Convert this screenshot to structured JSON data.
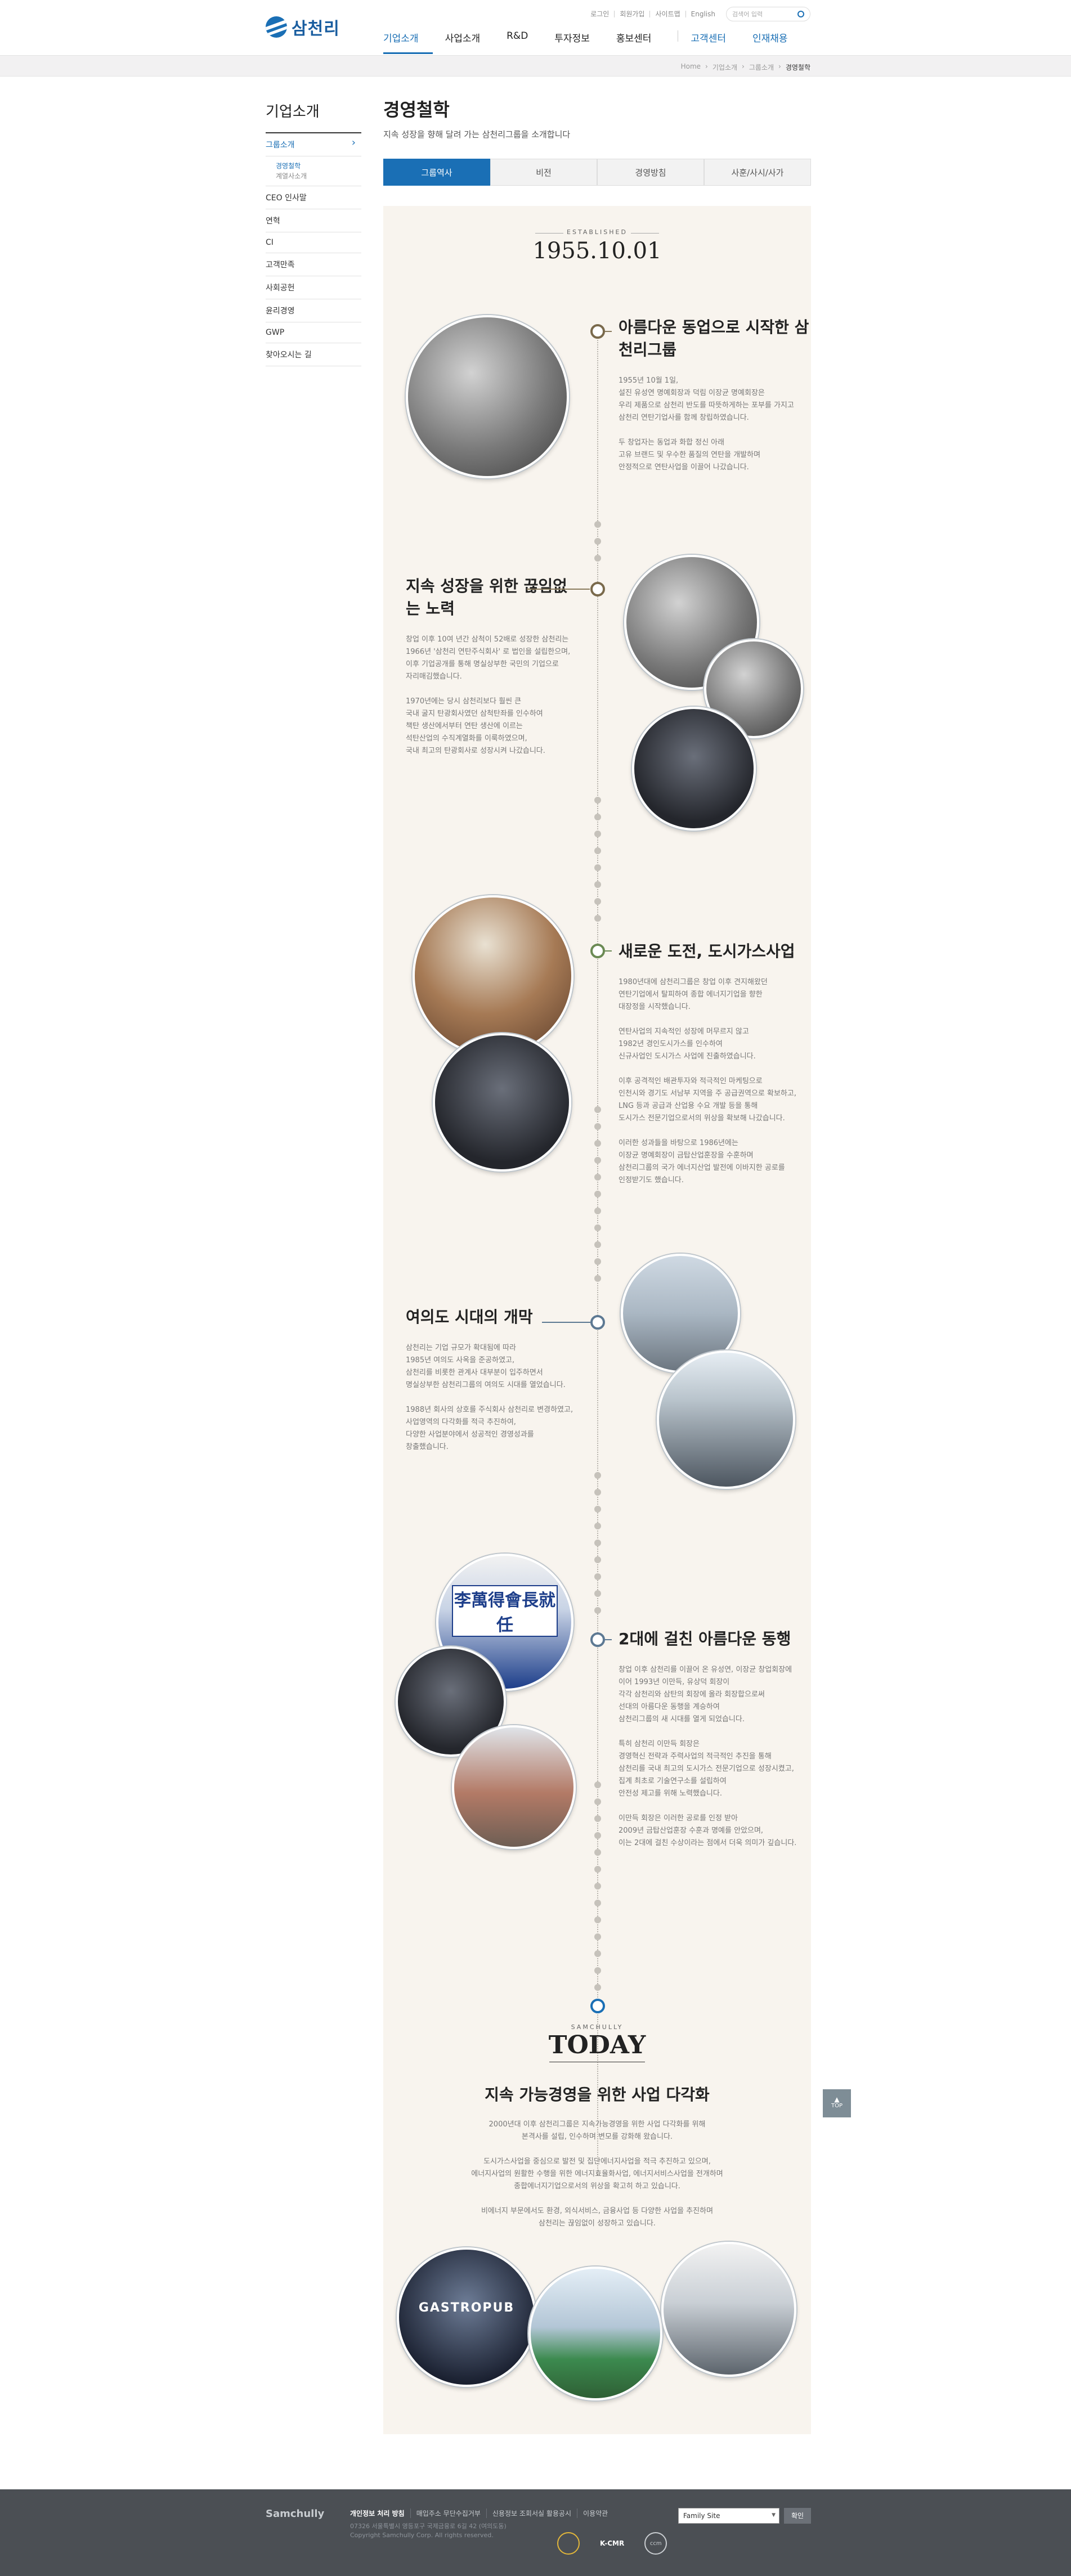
{
  "header": {
    "logo": "삼천리",
    "util_links": [
      "로그인",
      "회원가입",
      "사이트맵",
      "English"
    ],
    "search_placeholder": "검색어 입력",
    "gnb": [
      "기업소개",
      "사업소개",
      "R&D",
      "투자정보",
      "홍보센터",
      "고객센터",
      "인재채용"
    ]
  },
  "breadcrumb": [
    "Home",
    "기업소개",
    "그룹소개",
    "경영철학"
  ],
  "lnb": {
    "title": "기업소개",
    "group": "그룹소개",
    "sub": [
      "경영철학",
      "계열사소개"
    ],
    "items": [
      "CEO 인사말",
      "연혁",
      "CI",
      "고객만족",
      "사회공헌",
      "윤리경영",
      "GWP",
      "찾아오시는 길"
    ]
  },
  "content": {
    "title": "경영철학",
    "desc": "지속 성장을 향해 달려 가는 삼천리그룹을 소개합니다",
    "tabs": [
      "그룹역사",
      "비전",
      "경영방침",
      "사훈/사시/사가"
    ]
  },
  "history": {
    "established_label": "ESTABLISHED",
    "established_date": "1955.10.01",
    "sections": [
      {
        "title": "아름다운 동업으로 시작한 삼천리그룹",
        "text": "1955년 10월 1일,\n설진 유성연 명예회장과 덕림 이장균 명예회장은\n우리 제품으로 삼천리 반도를 따뜻하게하는 포부를 가지고\n삼천리 연탄기업사를 함께 창립하였습니다.\n\n두 창업자는 동업과 화합 정신 아래\n고유 브랜드 및 우수한 품질의 연탄을 개발하며\n안정적으로 연탄사업을 이끌어 나갔습니다."
      },
      {
        "title": "지속 성장을 위한 끊임없는 노력",
        "text": "창업 이후 10여 년간 삼척이 52배로 성장한 삼천리는\n1966년 '삼천리 연탄주식회사' 로 법인을 설립한으며,\n이후 기업공개를 통해 명실상부한 국민의 기업으로\n자리매김했습니다.\n\n1970년에는 당시 삼천리보다 훨씬 큰\n국내 굴지 탄광회사였던 삼척탄좌를 인수하여\n책탄 생산에서부터 연탄 생산에 이르는\n석탄산업의 수직계열화를 이룩하였으며,\n국내 최고의 탄광회사로 성장시켜 나갔습니다."
      },
      {
        "title": "새로운 도전, 도시가스사업",
        "text": "1980년대에 삼천리그룹은 창업 이후 견지해왔던\n연탄기업에서 탈피하여 종합 에너지기업을 향한\n대장정을 시작했습니다.\n\n연탄사업의 지속적인 성장에 머무르지 않고\n1982년 경인도시가스를 인수하여\n신규사업인 도시가스 사업에 진출하였습니다.\n\n이후 공격적인 배관투자와 적극적인 마케팅으로\n인천시와 경기도 서남부 지역을 주 공급권역으로 확보하고,\nLNG 등과 공급과 산업용 수요 개발 등을 통해\n도시가스 전문기업으로서의 위상을 확보해 나갔습니다.\n\n이러한 성과들을 바탕으로 1986년에는\n이장균 명예회장이 금탑산업훈장을 수훈하며\n삼천리그룹의 국가 에너지산업 발전에 이바지한 공로를\n인정받기도 했습니다."
      },
      {
        "title": "여의도 시대의 개막",
        "text": "삼천리는 기업 규모가 확대됨에 따라\n1985년 여의도 사옥을 준공하였고,\n삼천리를 비롯한 관계사 대부분이 입주하면서\n명실상부한 삼천리그룹의 여의도 시대를 열었습니다.\n\n1988년 회사의 상호를 주식회사 삼천리로 변경하였고,\n사업영역의 다각화를 적극 추진하여,\n다양한 사업분야에서 성공적인 경영성과를\n창출했습니다."
      },
      {
        "title": "2대에 걸친 아름다운 동행",
        "text": "창업 이후 삼천리를 이끌어 온 유성연, 이장균 창업회장에\n이어 1993년 이만득, 유상덕 회장이\n각각 삼천리와 삼탄의 회장에 올라 회장합으로써\n선대의 아름다운 동행을 계승하여\n삼천리그룹의 새 시대를 열게 되었습니다.\n\n특히 삼천리 이만득 회장은\n경영혁신 전략과 주력사업의 적극적인 추진을 통해\n삼천리를 국내 최고의 도시가스 전문기업으로 성장시켰고,\n집계 최초로 기술연구소를 설립하여\n안전성 제고를 위해 노력했습니다.\n\n이만득 회장은 이러한 공로를 인정 받아\n2009년 금탑산업훈장 수훈과 명예를 안았으며,\n이는 2대에 걸친 수상이라는 점에서 더욱 의미가 깊습니다."
      }
    ],
    "today_label": "SAMCHULLY",
    "today_big": "TODAY",
    "today_title": "지속 가능경영을 위한 사업 다각화",
    "today_text": "2000년대 이후 삼천리그룹은 지속가능경영을 위한 사업 다각화를 위해\n본격사를 설립, 인수하며 변모를 강화해 왔습니다.\n\n도시가스사업을 중심으로 발전 및 집단에너지사업을 적극 추진하고 있으며,\n에너지사업의 원활한 수행을 위한 에너지효율화사업, 에너지서비스사업을 전개하며\n종합에너지기업으로서의 위상을 확고히 하고 있습니다.\n\n비에너지 부문에서도 환경, 외식서비스, 금융사업 등 다양한 사업을 추진하며\n삼천리는 끊임없이 성장하고 있습니다.",
    "photo_labels": [
      "李萬得會長就任",
      "GASTROPUB"
    ]
  },
  "top_button": "TOP",
  "footer": {
    "logo": "Samchully",
    "links": [
      "개인정보 처리 방침",
      "매입주소 무단수집거부",
      "신용정보 조회서실 활용공시",
      "이용약관"
    ],
    "address": "07326 서울특별시 영등포구 국제금융로 6길 42 (여의도동)\nCopyright Samchully Corp. All rights reserved.",
    "family_site": "Family Site",
    "go": "확인",
    "badges": [
      "K-CMR",
      "ccm"
    ]
  },
  "colors": {
    "accent": "#1a6fb5",
    "footer_bg": "#4b4f54",
    "paper_bg": "#f8f4ee"
  }
}
